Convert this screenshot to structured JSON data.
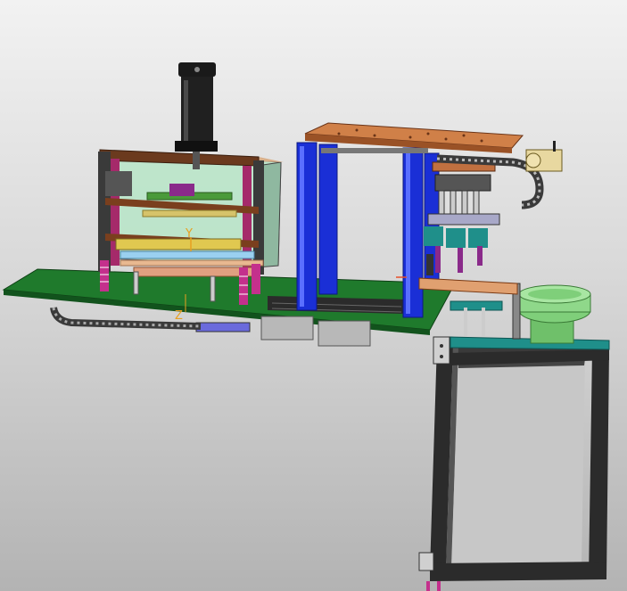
{
  "axes": {
    "y_label": "Y",
    "z_label": "Z"
  },
  "colors": {
    "background_top": "#f2f2f2",
    "background_bottom": "#b3b3b3",
    "base_plate": "#1f7a2c",
    "gantry_column": "#1a2fd6",
    "copper_plate": "#b8612e",
    "press_cylinder": "#1a1a1a",
    "pneumatic_spring": "#c4308c",
    "vibratory_bowl": "#8fd88a",
    "teal_bracket": "#1f8f8a",
    "stand_frame": "#2b2b2b",
    "cable_chain": "#3a3a3a"
  },
  "components": [
    {
      "name": "press-cylinder",
      "icon": "cylinder-icon"
    },
    {
      "name": "press-frame",
      "icon": "frame-icon"
    },
    {
      "name": "base-plate",
      "icon": "plate-icon"
    },
    {
      "name": "gantry",
      "icon": "gantry-icon"
    },
    {
      "name": "pick-place-head",
      "icon": "gripper-icon"
    },
    {
      "name": "cable-chain",
      "icon": "chain-icon"
    },
    {
      "name": "vibratory-bowl-feeder",
      "icon": "bowl-icon"
    },
    {
      "name": "feeder-stand",
      "icon": "stand-icon"
    }
  ]
}
